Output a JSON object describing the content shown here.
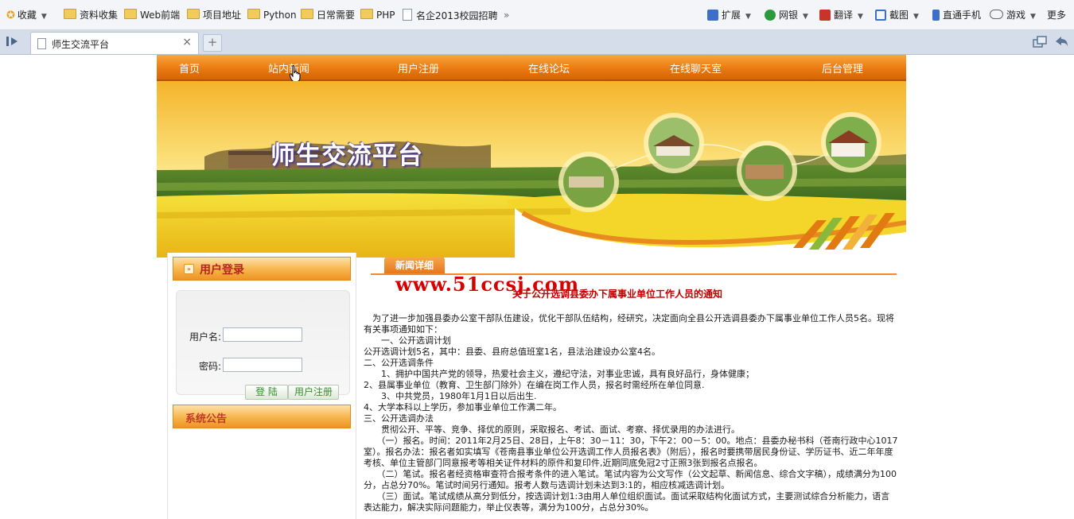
{
  "browser": {
    "bookmarks": [
      {
        "label": "收藏",
        "kind": "star"
      },
      {
        "label": "资料收集",
        "kind": "folder"
      },
      {
        "label": "Web前端",
        "kind": "folder"
      },
      {
        "label": "项目地址",
        "kind": "folder"
      },
      {
        "label": "Python",
        "kind": "folder"
      },
      {
        "label": "日常需要",
        "kind": "folder"
      },
      {
        "label": "PHP",
        "kind": "folder"
      },
      {
        "label": "名企2013校园招聘",
        "kind": "page"
      }
    ],
    "overflow_label": "»",
    "extensions": [
      {
        "label": "扩展",
        "icon": "extensions-icon",
        "color": "#3d6fc8"
      },
      {
        "label": "网银",
        "icon": "bank-icon",
        "color": "#2c9a3c"
      },
      {
        "label": "翻译",
        "icon": "translate-icon",
        "color": "#c8342c"
      },
      {
        "label": "截图",
        "icon": "screenshot-icon",
        "color": "#3d6fc8"
      },
      {
        "label": "直通手机",
        "icon": "phone-icon",
        "color": "#3d6fc8"
      },
      {
        "label": "游戏",
        "icon": "gamepad-icon",
        "color": "#666666"
      },
      {
        "label": "更多",
        "icon": "more-icon",
        "color": "#666666"
      }
    ],
    "tab": {
      "title": "师生交流平台",
      "close": "×"
    },
    "new_tab": "+"
  },
  "nav": {
    "items": [
      "首页",
      "站内新闻",
      "用户注册",
      "在线论坛",
      "在线聊天室",
      "后台管理"
    ]
  },
  "banner": {
    "title": "师生交流平台"
  },
  "login": {
    "title": "用户登录",
    "username_label": "用户名:",
    "password_label": "密码:",
    "username_value": "",
    "password_value": "",
    "login_button": "登 陆",
    "register_button": "用户注册"
  },
  "announcement": {
    "title": "系统公告"
  },
  "news": {
    "tab_label": "新闻详细",
    "watermark": "www.51ccsj.com",
    "title": "关于公开选调县委办下属事业单位工作人员的通知",
    "paragraphs": [
      "　为了进一步加强县委办公室干部队伍建设，优化干部队伍结构，经研究，决定面向全县公开选调县委办下属事业单位工作人员5名。现将有关事项通知如下：",
      "　　一、公开选调计划",
      "公开选调计划5名，其中：县委、县府总值班室1名，县法治建设办公室4名。",
      "二、公开选调条件",
      "　　1、拥护中国共产党的领导，热爱社会主义，遵纪守法，对事业忠诚，具有良好品行，身体健康；",
      "2、县属事业单位（教育、卫生部门除外）在编在岗工作人员，报名时需经所在单位同意.",
      "　　3、中共党员，1980年1月1日以后出生.",
      "4、大学本科以上学历，参加事业单位工作满二年。",
      "三、公开选调办法",
      "　　贯彻公开、平等、竞争、择优的原则，采取报名、考试、面试、考察、择优录用的办法进行。",
      "　　（一）报名。时间：2011年2月25日、28日，上午8：30－11：30，下午2：00－5：00。地点：县委办秘书科（苍南行政中心1017室）。报名办法：报名者如实填写《苍南县事业单位公开选调工作人员报名表》（附后），报名时要携带居民身份证、学历证书、近二年年度考核、单位主管部门同意报考等相关证件材料的原件和复印件,近期同底免冠2寸正照3张到报名点报名。",
      "　　（二）笔试。报名者经资格审查符合报考条件的进入笔试。笔试内容为公文写作（公文起草、新闻信息、综合文字稿），成绩满分为100分，占总分70%。笔试时间另行通知。报考人数与选调计划未达到3:1的，相应核减选调计划。",
      "　　（三）面试。笔试成绩从高分到低分，按选调计划1:3由用人单位组织面试。面试采取结构化面试方式，主要测试综合分析能力，语言表达能力，解决实际问题能力，举止仪表等，满分为100分，占总分30%。"
    ]
  }
}
